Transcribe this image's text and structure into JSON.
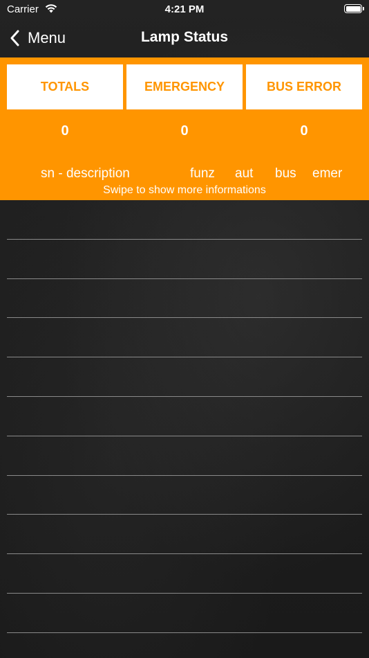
{
  "status_bar": {
    "carrier": "Carrier",
    "time": "4:21 PM",
    "icons": [
      "wifi-icon",
      "battery-icon"
    ]
  },
  "nav": {
    "back_label": "Menu",
    "title": "Lamp Status"
  },
  "colors": {
    "accent": "#ff9500",
    "background": "#1d1d1d",
    "text": "#ffffff",
    "row_separator": "#8a8a8a"
  },
  "tabs": [
    {
      "label": "TOTALS",
      "count": "0"
    },
    {
      "label": "EMERGENCY",
      "count": "0"
    },
    {
      "label": "BUS ERROR",
      "count": "0"
    }
  ],
  "table_header": {
    "sn_description": "sn - description",
    "funz": "funz",
    "aut": "aut",
    "bus": "bus",
    "emer": "emer"
  },
  "swipe_hint": "Swipe to show more informations"
}
